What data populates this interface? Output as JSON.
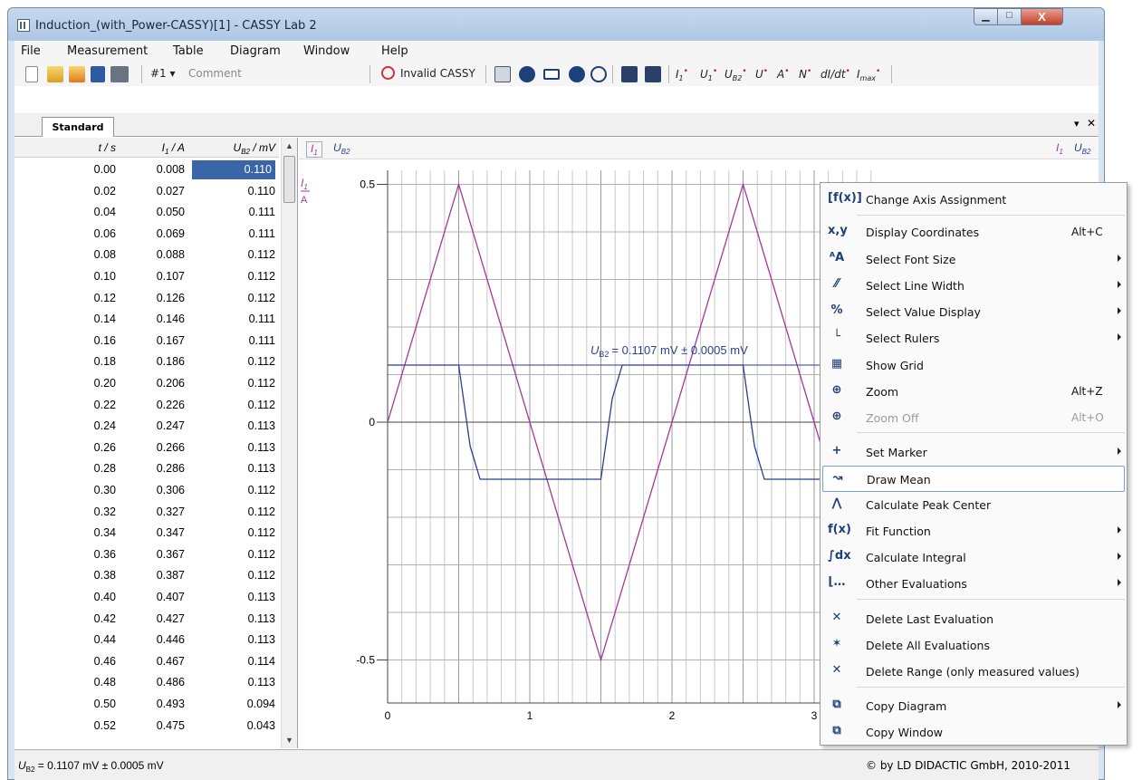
{
  "window": {
    "title": "Induction_(with_Power-CASSY)[1] - CASSY Lab 2",
    "min_glyph": "▁",
    "max_glyph": "□",
    "close_glyph": "X"
  },
  "menu": [
    "File",
    "Measurement",
    "Table",
    "Diagram",
    "Window",
    "Help"
  ],
  "toolbar": {
    "series_label": "#1 ▾",
    "comment_placeholder": "Comment",
    "status": "Invalid CASSY",
    "qty_I1": "I",
    "qty_U1": "U",
    "qty_UB2": "U",
    "qty_U": "U",
    "qty_A": "A",
    "qty_N": "N",
    "qty_didt": "dI/dt",
    "qty_Imax": "I",
    "sub_1": "1",
    "sub_B2": "B2",
    "sub_max": "max",
    "dot": "•"
  },
  "tab": {
    "label": "Standard",
    "menu_glyph": "▾",
    "close_glyph": "✕"
  },
  "table": {
    "columns": [
      "t / s",
      "I1 / A",
      "UB2 / mV"
    ],
    "col_t": "t / s",
    "col_I_main": "I",
    "col_I_sub": "1",
    "col_I_unit": " / A",
    "col_U_main": "U",
    "col_U_sub": "B2",
    "col_U_unit": " / mV",
    "rows": [
      [
        "0.00",
        "0.008",
        "0.110"
      ],
      [
        "0.02",
        "0.027",
        "0.110"
      ],
      [
        "0.04",
        "0.050",
        "0.111"
      ],
      [
        "0.06",
        "0.069",
        "0.111"
      ],
      [
        "0.08",
        "0.088",
        "0.112"
      ],
      [
        "0.10",
        "0.107",
        "0.112"
      ],
      [
        "0.12",
        "0.126",
        "0.112"
      ],
      [
        "0.14",
        "0.146",
        "0.111"
      ],
      [
        "0.16",
        "0.167",
        "0.111"
      ],
      [
        "0.18",
        "0.186",
        "0.112"
      ],
      [
        "0.20",
        "0.206",
        "0.112"
      ],
      [
        "0.22",
        "0.226",
        "0.112"
      ],
      [
        "0.24",
        "0.247",
        "0.113"
      ],
      [
        "0.26",
        "0.266",
        "0.113"
      ],
      [
        "0.28",
        "0.286",
        "0.113"
      ],
      [
        "0.30",
        "0.306",
        "0.112"
      ],
      [
        "0.32",
        "0.327",
        "0.112"
      ],
      [
        "0.34",
        "0.347",
        "0.112"
      ],
      [
        "0.36",
        "0.367",
        "0.112"
      ],
      [
        "0.38",
        "0.387",
        "0.112"
      ],
      [
        "0.40",
        "0.407",
        "0.113"
      ],
      [
        "0.42",
        "0.427",
        "0.113"
      ],
      [
        "0.44",
        "0.446",
        "0.113"
      ],
      [
        "0.46",
        "0.467",
        "0.114"
      ],
      [
        "0.48",
        "0.486",
        "0.113"
      ],
      [
        "0.50",
        "0.493",
        "0.094"
      ],
      [
        "0.52",
        "0.475",
        "0.043"
      ]
    ]
  },
  "diagram": {
    "tab_I1": "I",
    "tab_UB2": "U",
    "sub_1": "1",
    "sub_B2": "B2",
    "axis_label_I": "I",
    "axis_label_sub": "1",
    "axis_label_unit": "A",
    "y_ticks": [
      "0.5",
      "0",
      "-0.5"
    ],
    "x_ticks": [
      "0",
      "1",
      "2",
      "3"
    ],
    "mean_label": "= 0.1107 mV ± 0.0005 mV",
    "mean_label_main": "U",
    "mean_label_sub": "B2",
    "color_I1": "#a0389c",
    "color_UB2": "#2a3f8f"
  },
  "chart_data": {
    "type": "line",
    "title": "",
    "xlabel": "",
    "ylabel": "I1 / A",
    "xlim": [
      0,
      3.5
    ],
    "ylim": [
      -0.55,
      0.55
    ],
    "series": [
      {
        "name": "I1",
        "x": [
          0.0,
          0.5,
          1.5,
          2.5,
          3.5
        ],
        "y": [
          0.0,
          0.5,
          -0.5,
          0.5,
          -0.5
        ]
      },
      {
        "name": "UB2",
        "x": [
          0.0,
          0.5,
          0.58,
          0.65,
          1.2,
          1.45,
          1.5,
          1.58,
          1.65,
          2.2,
          2.5,
          2.58,
          2.65,
          3.2,
          3.45
        ],
        "y": [
          0.12,
          0.12,
          -0.05,
          -0.12,
          -0.12,
          -0.12,
          -0.12,
          0.05,
          0.12,
          0.12,
          0.12,
          -0.05,
          -0.12,
          -0.12,
          -0.12
        ]
      }
    ],
    "mean_line_y": 0.12,
    "grid": true
  },
  "context_menu": {
    "items": [
      {
        "icon": "[f(x)]",
        "label": "Change Axis Assignment",
        "short": "",
        "sub": false
      },
      {
        "icon": "x,y",
        "label": "Display Coordinates",
        "short": "Alt+C",
        "sub": false
      },
      {
        "icon": "ᴬA",
        "label": "Select Font Size",
        "short": "",
        "sub": true
      },
      {
        "icon": "⁄⁄",
        "label": "Select Line Width",
        "short": "",
        "sub": true
      },
      {
        "icon": "%",
        "label": "Select Value Display",
        "short": "",
        "sub": true
      },
      {
        "icon": "└",
        "label": "Select Rulers",
        "short": "",
        "sub": true
      },
      {
        "icon": "▦",
        "label": "Show Grid",
        "short": "",
        "sub": false
      },
      {
        "icon": "⊕",
        "label": "Zoom",
        "short": "Alt+Z",
        "sub": false
      },
      {
        "icon": "⊕",
        "label": "Zoom Off",
        "short": "Alt+O",
        "sub": false,
        "disabled": true
      },
      {
        "icon": "+",
        "label": "Set Marker",
        "short": "",
        "sub": true
      },
      {
        "icon": "↝",
        "label": "Draw Mean",
        "short": "",
        "sub": false,
        "hover": true
      },
      {
        "icon": "⋀",
        "label": "Calculate Peak Center",
        "short": "",
        "sub": false
      },
      {
        "icon": "f(x)",
        "label": "Fit Function",
        "short": "",
        "sub": true
      },
      {
        "icon": "∫dx",
        "label": "Calculate Integral",
        "short": "",
        "sub": true
      },
      {
        "icon": "⌊…",
        "label": "Other Evaluations",
        "short": "",
        "sub": true
      },
      {
        "icon": "✕",
        "label": "Delete Last Evaluation",
        "short": "",
        "sub": false
      },
      {
        "icon": "✶",
        "label": "Delete All Evaluations",
        "short": "",
        "sub": false
      },
      {
        "icon": "✕",
        "label": "Delete Range (only measured values)",
        "short": "",
        "sub": false
      },
      {
        "icon": "⧉",
        "label": "Copy Diagram",
        "short": "",
        "sub": true
      },
      {
        "icon": "⧉",
        "label": "Copy Window",
        "short": "",
        "sub": false
      }
    ]
  },
  "statusbar": {
    "left_main": "U",
    "left_sub": "B2",
    "left_rest": " = 0.1107 mV ± 0.0005 mV",
    "right": "© by LD DIDACTIC GmbH, 2010-2011"
  }
}
